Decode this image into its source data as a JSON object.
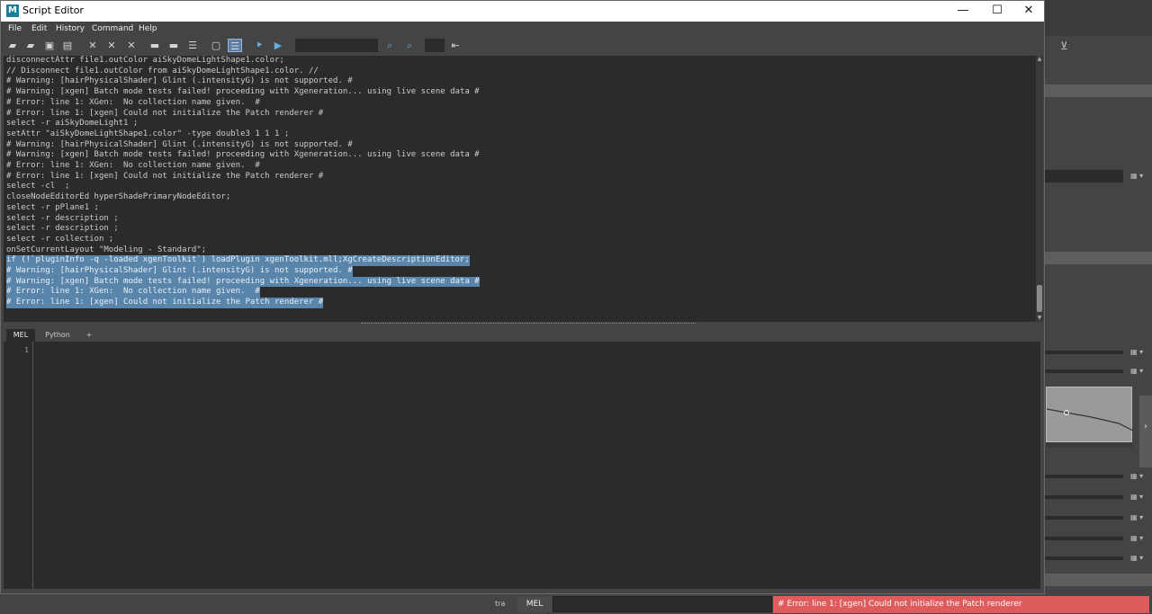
{
  "window": {
    "title": "Script Editor",
    "logo": "M",
    "minimize": "—",
    "maximize": "☐",
    "close": "✕"
  },
  "menu": [
    "File",
    "Edit",
    "History",
    "Command",
    "Help"
  ],
  "toolbar_icons": [
    "open-script-icon",
    "source-script-icon",
    "save-script-icon",
    "save-to-shelf-icon",
    "clear-history-icon",
    "clear-input-icon",
    "clear-all-icon",
    "show-history-icon",
    "show-input-icon",
    "show-both-icon",
    "echo-all-icon",
    "line-numbers-icon",
    "execute-all-icon",
    "execute-icon",
    "search-icon",
    "search-next-icon",
    "indent-icon"
  ],
  "history": [
    {
      "text": "disconnectAttr file1.outColor aiSkyDomeLightShape1.color;",
      "selected": false
    },
    {
      "text": "// Disconnect file1.outColor from aiSkyDomeLightShape1.color. //",
      "selected": false
    },
    {
      "text": "# Warning: [hairPhysicalShader] Glint (.intensityG) is not supported. #",
      "selected": false
    },
    {
      "text": "# Warning: [xgen] Batch mode tests failed! proceeding with Xgeneration... using live scene data #",
      "selected": false
    },
    {
      "text": "# Error: line 1: XGen:  No collection name given.  #",
      "selected": false
    },
    {
      "text": "# Error: line 1: [xgen] Could not initialize the Patch renderer #",
      "selected": false
    },
    {
      "text": "select -r aiSkyDomeLight1 ;",
      "selected": false
    },
    {
      "text": "setAttr \"aiSkyDomeLightShape1.color\" -type double3 1 1 1 ;",
      "selected": false
    },
    {
      "text": "# Warning: [hairPhysicalShader] Glint (.intensityG) is not supported. #",
      "selected": false
    },
    {
      "text": "# Warning: [xgen] Batch mode tests failed! proceeding with Xgeneration... using live scene data #",
      "selected": false
    },
    {
      "text": "# Error: line 1: XGen:  No collection name given.  #",
      "selected": false
    },
    {
      "text": "# Error: line 1: [xgen] Could not initialize the Patch renderer #",
      "selected": false
    },
    {
      "text": "select -cl  ;",
      "selected": false
    },
    {
      "text": "closeNodeEditorEd hyperShadePrimaryNodeEditor;",
      "selected": false
    },
    {
      "text": "select -r pPlane1 ;",
      "selected": false
    },
    {
      "text": "select -r description ;",
      "selected": false
    },
    {
      "text": "select -r description ;",
      "selected": false
    },
    {
      "text": "select -r collection ;",
      "selected": false
    },
    {
      "text": "onSetCurrentLayout \"Modeling - Standard\";",
      "selected": false
    },
    {
      "text": "if (!`pluginInfo -q -loaded xgenToolkit`) loadPlugin xgenToolkit.mll;XgCreateDescriptionEditor;",
      "selected": true
    },
    {
      "text": "# Warning: [hairPhysicalShader] Glint (.intensityG) is not supported. #",
      "selected": true
    },
    {
      "text": "# Warning: [xgen] Batch mode tests failed! proceeding with Xgeneration... using live scene data #",
      "selected": true
    },
    {
      "text": "# Error: line 1: XGen:  No collection name given.  #",
      "selected": true
    },
    {
      "text": "# Error: line 1: [xgen] Could not initialize the Patch renderer #",
      "selected": true
    }
  ],
  "tabs": [
    "MEL",
    "Python",
    "+"
  ],
  "input": {
    "line_number": "1"
  },
  "status": {
    "lang_short": "tra",
    "language": "MEL",
    "message": "# Error: line 1: [xgen] Could not initialize the Patch renderer"
  },
  "colors": {
    "selection": "#5a85aa",
    "error_bar": "#e05c5c",
    "editor_bg": "#2b2b2b",
    "panel_bg": "#444444"
  }
}
